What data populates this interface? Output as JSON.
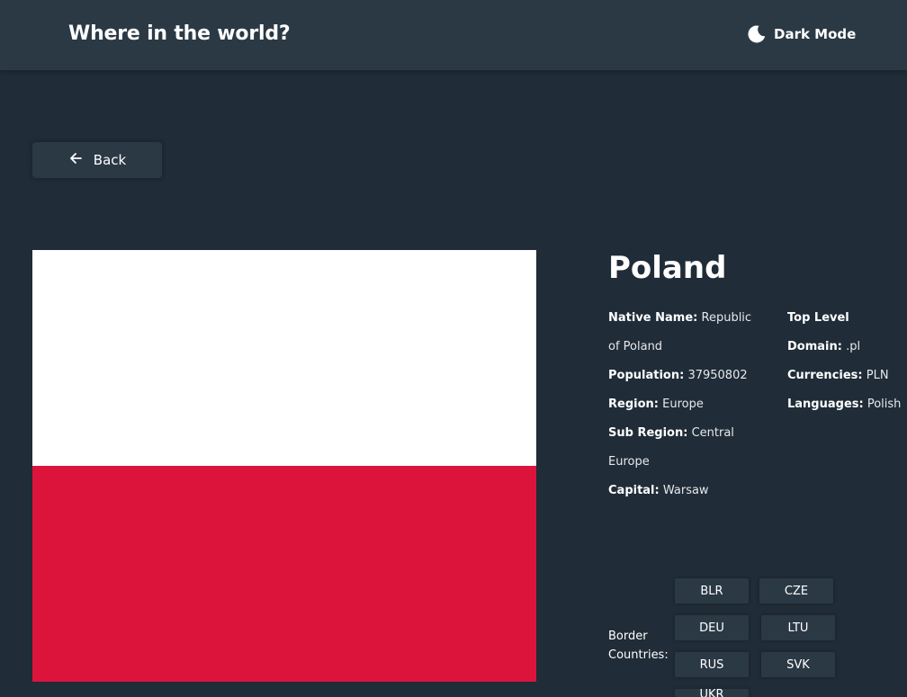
{
  "header": {
    "title": "Where in the world?",
    "theme_toggle_label": "Dark Mode",
    "theme_icon": "moon-icon"
  },
  "back_button": {
    "label": "Back",
    "icon": "arrow-left-icon"
  },
  "country": {
    "name": "Poland",
    "flag": {
      "top_color": "#ffffff",
      "bottom_color": "#dc143c"
    },
    "native_name_label": "Native Name:",
    "native_name": "Republic of Poland",
    "population_label": "Population:",
    "population": "37950802",
    "region_label": "Region:",
    "region": "Europe",
    "sub_region_label": "Sub Region:",
    "sub_region": "Central Europe",
    "capital_label": "Capital:",
    "capital": "Warsaw",
    "tld_label": "Top Level Domain:",
    "tld": ".pl",
    "currencies_label": "Currencies:",
    "currencies": "PLN",
    "languages_label": "Languages:",
    "languages": "Polish"
  },
  "border": {
    "label": "Border Countries:",
    "countries": [
      "BLR",
      "CZE",
      "DEU",
      "LTU",
      "RUS",
      "SVK",
      "UKR"
    ]
  },
  "colors": {
    "background": "#202c37",
    "elements": "#2b3945",
    "text": "#ffffff"
  }
}
